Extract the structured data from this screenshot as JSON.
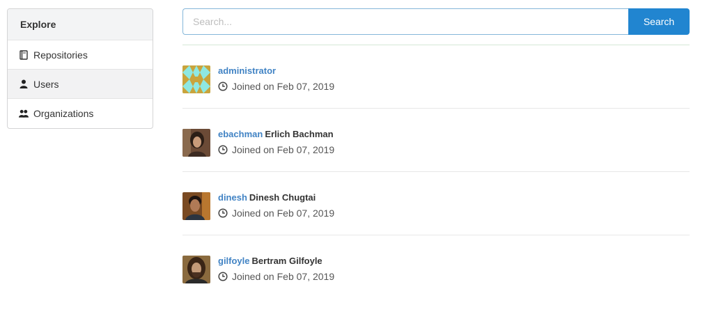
{
  "sidebar": {
    "header": "Explore",
    "items": [
      {
        "label": "Repositories",
        "icon": "book-icon",
        "active": false
      },
      {
        "label": "Users",
        "icon": "user-icon",
        "active": true
      },
      {
        "label": "Organizations",
        "icon": "organization-icon",
        "active": false
      }
    ]
  },
  "search": {
    "placeholder": "Search...",
    "value": "",
    "button_label": "Search"
  },
  "users": [
    {
      "login": "administrator",
      "full_name": "",
      "joined": "Joined on Feb 07, 2019",
      "avatar": "identicon"
    },
    {
      "login": "ebachman",
      "full_name": "Erlich Bachman",
      "joined": "Joined on Feb 07, 2019",
      "avatar": "photo"
    },
    {
      "login": "dinesh",
      "full_name": "Dinesh Chugtai",
      "joined": "Joined on Feb 07, 2019",
      "avatar": "photo"
    },
    {
      "login": "gilfoyle",
      "full_name": "Bertram Gilfoyle",
      "joined": "Joined on Feb 07, 2019",
      "avatar": "photo"
    }
  ],
  "colors": {
    "accent": "#2185d0",
    "link": "#4183c4"
  }
}
